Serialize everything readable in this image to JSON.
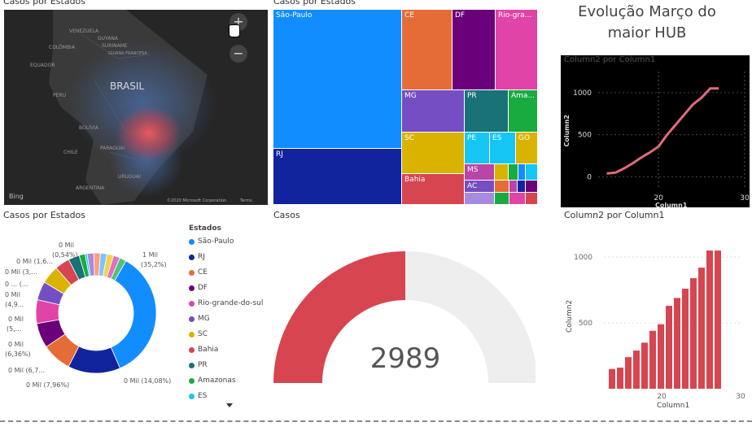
{
  "map": {
    "title": "Casos por Estados",
    "labels": {
      "country": "BRASIL",
      "venezuela": "VENEZUELA",
      "guyana": "GUYANA",
      "colombia": "COLÔMBIA",
      "suriname": "SURINAME",
      "french_guiana": "GUIANA FRANCESA",
      "equador": "EQUADOR",
      "peru": "PERU",
      "bolivia": "BOLÍVIA",
      "paraguai": "PARAGUAI",
      "chile": "CHILE",
      "uruguai": "URUGUAI",
      "argentina": "ARGENTINA"
    },
    "zoom_in": "+",
    "zoom_out": "−",
    "brand": "Bing",
    "copyright": "©2020 Microsoft Corporation",
    "terms": "Terms"
  },
  "treemap": {
    "title": "Casos por Estados",
    "cells": [
      {
        "label": "São-Paulo",
        "color": "#118DFF"
      },
      {
        "label": "RJ",
        "color": "#12239E"
      },
      {
        "label": "CE",
        "color": "#E66C37"
      },
      {
        "label": "DF",
        "color": "#6B007B"
      },
      {
        "label": "Rio-gra...",
        "color": "#E044A7"
      },
      {
        "label": "MG",
        "color": "#744EC2"
      },
      {
        "label": "PR",
        "color": "#197278"
      },
      {
        "label": "Ama...",
        "color": "#1AAB40"
      },
      {
        "label": "SC",
        "color": "#D9B300"
      },
      {
        "label": "PE",
        "color": "#15C6F4"
      },
      {
        "label": "ES",
        "color": "#15C6F4"
      },
      {
        "label": "GO",
        "color": "#D9B300"
      },
      {
        "label": "Bahia",
        "color": "#D64550"
      },
      {
        "label": "MS",
        "color": "#B845A7"
      },
      {
        "label": "AC",
        "color": "#744EC2"
      }
    ]
  },
  "heading": {
    "line1": "Evolução Março do",
    "line2": "maior HUB"
  },
  "dark_chart": {
    "title": "Column2 por Column1",
    "xlabel": "Column1",
    "ylabel": "Column2",
    "x_ticks": [
      "20",
      "30"
    ],
    "y_ticks": [
      "0",
      "500",
      "1000"
    ]
  },
  "donut": {
    "title": "Casos por Estados",
    "legend_title": "Estados",
    "labels": {
      "sp": "1 Mil",
      "sp_pct": "(35,2%)",
      "rj": "0 Mil (14,08%)",
      "ce": "0 Mil (7,96%)",
      "df": "0 Mil (6,7...",
      "rgs": "0 Mil",
      "rgs_pct": "(6,36%)",
      "mg": "0 Mil",
      "mg_pct": "(5,...",
      "sc": "0 Mil",
      "sc_pct": "(4,9...",
      "bahia": "0 ... (...",
      "pr": "0 Mil (3,...",
      "ama": "0 Mil (1,6...",
      "small": "0 Mil",
      "small_pct": "(0,54%)"
    }
  },
  "gauge": {
    "title": "Casos",
    "value": "2989",
    "fill_fraction": 0.5
  },
  "bar_chart": {
    "title": "Column2 por Column1",
    "xlabel": "Column1",
    "ylabel": "Column2",
    "x_ticks": [
      "20",
      "30"
    ],
    "y_ticks": [
      "500",
      "1000"
    ]
  },
  "colors": {
    "sp": "#118DFF",
    "rj": "#12239E",
    "ce": "#E66C37",
    "df": "#6B007B",
    "rgs": "#E044A7",
    "mg": "#744EC2",
    "sc": "#D9B300",
    "bahia": "#D64550",
    "pr": "#197278",
    "ama": "#1AAB40",
    "es": "#15C6F4",
    "bar": "#D64550",
    "gauge_fill": "#D64550",
    "gauge_track": "#EEEEEE",
    "line": "#E06C78"
  },
  "chart_data": [
    {
      "type": "line",
      "title": "Column2 por Column1",
      "xlabel": "Column1",
      "ylabel": "Column2",
      "x": [
        14,
        15,
        16,
        17,
        18,
        19,
        20,
        21,
        22,
        23,
        24,
        25,
        26,
        27
      ],
      "series": [
        {
          "values": [
            40,
            50,
            100,
            160,
            230,
            290,
            360,
            500,
            620,
            740,
            860,
            940,
            1050,
            1050
          ]
        }
      ],
      "xlim": [
        13,
        30
      ],
      "ylim": [
        -150,
        1250
      ]
    },
    {
      "type": "pie",
      "title": "Casos por Estados",
      "legend_title": "Estados",
      "categories": [
        "São-Paulo",
        "RJ",
        "CE",
        "DF",
        "Rio-grande-do-sul",
        "MG",
        "SC",
        "Bahia",
        "PR",
        "Amazonas",
        "ES"
      ],
      "values": [
        35.2,
        14.08,
        7.96,
        6.7,
        6.36,
        5.0,
        4.9,
        4.0,
        3.0,
        1.6,
        0.54
      ],
      "legend_position": "right"
    },
    {
      "type": "bar",
      "title": "Column2 por Column1",
      "xlabel": "Column1",
      "ylabel": "Column2",
      "categories": [
        "14",
        "15",
        "16",
        "17",
        "18",
        "19",
        "20",
        "21",
        "22",
        "23",
        "24",
        "25",
        "26",
        "27"
      ],
      "values": [
        150,
        160,
        240,
        290,
        350,
        440,
        490,
        630,
        690,
        760,
        840,
        920,
        1050,
        1050
      ],
      "ylim": [
        0,
        1100
      ]
    }
  ]
}
